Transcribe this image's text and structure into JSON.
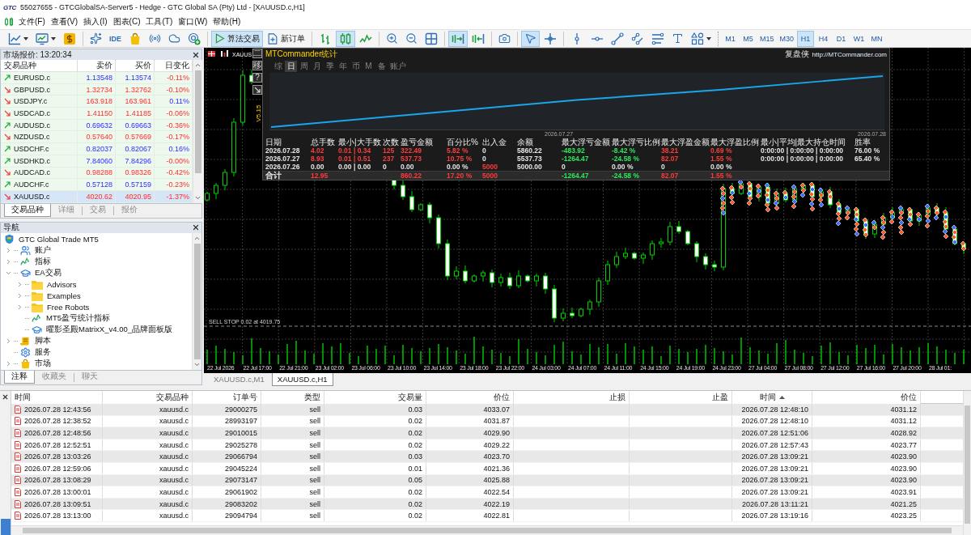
{
  "window": {
    "logo": "GTC",
    "title": "55027655 - GTCGlobalSA-Server5 - Hedge - GTC Global SA (Pty) Ltd - [XAUUSD.c,H1]"
  },
  "menu": [
    "文件(F)",
    "查看(V)",
    "插入(I)",
    "图表(C)",
    "工具(T)",
    "窗口(W)",
    "帮助(H)"
  ],
  "toolbar": {
    "ide_label": "IDE",
    "algo_trading": {
      "label": "算法交易",
      "on": true
    },
    "new_order": {
      "label": "新订单"
    },
    "chart_types": [
      {
        "selected": false
      },
      {
        "selected": true
      },
      {
        "selected": false
      }
    ],
    "auto_scroll": {
      "on": true
    },
    "chart_shift": {
      "on": false
    },
    "cursor_modes": [
      {
        "selected": true
      },
      {
        "selected": false
      }
    ],
    "timeframes": [
      {
        "label": "M1",
        "selected": false
      },
      {
        "label": "M5",
        "selected": false
      },
      {
        "label": "M15",
        "selected": false
      },
      {
        "label": "M30",
        "selected": false
      },
      {
        "label": "H1",
        "selected": true
      },
      {
        "label": "H4",
        "selected": false
      },
      {
        "label": "D1",
        "selected": false
      },
      {
        "label": "W1",
        "selected": false
      },
      {
        "label": "MN",
        "selected": false
      }
    ]
  },
  "market_watch": {
    "title": "市场报价: 13:20:34",
    "columns": [
      "交易品种",
      "卖价",
      "买价",
      "日变化"
    ],
    "rows": [
      {
        "symbol": "EURUSD.c",
        "bid": "1.13548",
        "ask": "1.13574",
        "change": "-0.11%",
        "rising": true,
        "change_rising": false,
        "selected": false
      },
      {
        "symbol": "GBPUSD.c",
        "bid": "1.32734",
        "ask": "1.32762",
        "change": "-0.10%",
        "rising": false,
        "change_rising": false,
        "selected": false
      },
      {
        "symbol": "USDJPY.c",
        "bid": "163.918",
        "ask": "163.961",
        "change": "0.11%",
        "rising": false,
        "change_rising": true,
        "selected": false
      },
      {
        "symbol": "USDCAD.c",
        "bid": "1.41150",
        "ask": "1.41185",
        "change": "-0.06%",
        "rising": false,
        "change_rising": false,
        "selected": false
      },
      {
        "symbol": "AUDUSD.c",
        "bid": "0.69632",
        "ask": "0.69663",
        "change": "-0.36%",
        "rising": true,
        "change_rising": false,
        "selected": false
      },
      {
        "symbol": "NZDUSD.c",
        "bid": "0.57640",
        "ask": "0.57669",
        "change": "-0.17%",
        "rising": false,
        "change_rising": false,
        "selected": false
      },
      {
        "symbol": "USDCHF.c",
        "bid": "0.82037",
        "ask": "0.82067",
        "change": "0.16%",
        "rising": true,
        "change_rising": true,
        "selected": false
      },
      {
        "symbol": "USDHKD.c",
        "bid": "7.84060",
        "ask": "7.84296",
        "change": "-0.00%",
        "rising": true,
        "change_rising": false,
        "selected": false
      },
      {
        "symbol": "AUDCAD.c",
        "bid": "0.98288",
        "ask": "0.98326",
        "change": "-0.42%",
        "rising": false,
        "change_rising": false,
        "selected": false
      },
      {
        "symbol": "AUDCHF.c",
        "bid": "0.57128",
        "ask": "0.57159",
        "change": "-0.23%",
        "rising": true,
        "change_rising": false,
        "selected": false
      },
      {
        "symbol": "XAUUSD.c",
        "bid": "4020.62",
        "ask": "4020.95",
        "change": "-1.37%",
        "rising": false,
        "change_rising": false,
        "selected": true
      }
    ],
    "tabs": [
      {
        "label": "交易品种",
        "selected": true
      },
      {
        "label": "详细",
        "selected": false
      },
      {
        "label": "交易",
        "selected": false
      },
      {
        "label": "报价",
        "selected": false
      }
    ]
  },
  "navigator": {
    "title": "导航",
    "tree": [
      {
        "label": "GTC Global Trade MT5",
        "kind": "root",
        "children": [
          {
            "label": "账户",
            "kind": "accounts",
            "expanded": false
          },
          {
            "label": "指标",
            "kind": "indicators",
            "expanded": false
          },
          {
            "label": "EA交易",
            "kind": "experts",
            "expanded": true,
            "children": [
              {
                "label": "Advisors",
                "kind": "folder",
                "expanded": false
              },
              {
                "label": "Examples",
                "kind": "folder",
                "expanded": false
              },
              {
                "label": "Free Robots",
                "kind": "folder",
                "expanded": false
              },
              {
                "label": "MT5盈亏统计指标",
                "kind": "indicator"
              },
              {
                "label": "曜影圣殿MatrixX_v4.00_品牌面板版",
                "kind": "expert"
              }
            ]
          },
          {
            "label": "脚本",
            "kind": "scripts",
            "expanded": false
          },
          {
            "label": "服务",
            "kind": "services"
          },
          {
            "label": "市场",
            "kind": "market",
            "expanded": false
          }
        ]
      }
    ],
    "tabs": [
      {
        "label": "注释",
        "selected": true
      },
      {
        "label": "收藏夹",
        "selected": false
      },
      {
        "label": "聊天",
        "selected": false
      }
    ]
  },
  "chart": {
    "symbol_label": "XAUUS",
    "version": "V5.15",
    "side_buttons": [
      "二",
      "移",
      "?"
    ],
    "pending_order": "SELL STOP 0.02 at 4019.75",
    "time_labels": [
      "22 Jul 2026",
      "22 Jul 17:00",
      "22 Jul 21:00",
      "23 Jul 02:00",
      "23 Jul 06:00",
      "23 Jul 10:00",
      "23 Jul 14:00",
      "23 Jul 18:00",
      "23 Jul 22:00",
      "24 Jul 03:00",
      "24 Jul 07:00",
      "24 Jul 11:00",
      "24 Jul 15:00",
      "24 Jul 19:00",
      "24 Jul 23:00",
      "27 Jul 04:00",
      "27 Jul 08:00",
      "27 Jul 12:00",
      "27 Jul 16:00",
      "27 Jul 20:00",
      "28 Jul 01:"
    ]
  },
  "stats_panel": {
    "title": "MTCommander统计",
    "brand": "复盘侠",
    "url": "http://MTCommander.com",
    "tabs": [
      {
        "label": "综",
        "selected": false
      },
      {
        "label": "日",
        "selected": true
      },
      {
        "label": "周",
        "selected": false
      },
      {
        "label": "月",
        "selected": false
      },
      {
        "label": "季",
        "selected": false
      },
      {
        "label": "年",
        "selected": false
      },
      {
        "label": "币",
        "selected": false
      },
      {
        "label": "M",
        "selected": false
      },
      {
        "label": "备",
        "selected": false
      },
      {
        "label": "账户",
        "selected": false
      }
    ],
    "date_labels": [
      "2026.07.27",
      "2026.07.28"
    ],
    "columns": [
      "日期",
      "总手数",
      "最小|大手数",
      "次数",
      "盈亏金额",
      "百分比%",
      "出入金",
      "余额",
      "最大浮亏金额",
      "最大浮亏比例",
      "最大浮盈金额",
      "最大浮盈比例",
      "最小|平均|最大持仓时间",
      "胜率"
    ],
    "rows": [
      {
        "date": {
          "text": "2026.07.28",
          "color": "#e6e6e6"
        },
        "total_lots": {
          "text": "4.02",
          "color": "#ff3b3b"
        },
        "min_max_lots": {
          "text": "0.01 | 0.34",
          "color": "#ff3b3b"
        },
        "trades": {
          "text": "125",
          "color": "#ff3b3b"
        },
        "profit": {
          "text": "322.49",
          "color": "#ff3b3b"
        },
        "percent": {
          "text": "5.82 %",
          "color": "#ff3b3b"
        },
        "deposit": {
          "text": "0",
          "color": "#e6e6e6"
        },
        "balance": {
          "text": "5860.22",
          "color": "#e6e6e6"
        },
        "max_float_loss": {
          "text": "-483.92",
          "color": "#2ee85c"
        },
        "max_float_loss_pct": {
          "text": "-8.42 %",
          "color": "#2ee85c"
        },
        "max_float_profit": {
          "text": "38.21",
          "color": "#ff3b3b"
        },
        "max_float_profit_pct": {
          "text": "0.69 %",
          "color": "#ff3b3b"
        },
        "hold_times": {
          "text": "0:00:00 | 0:00:00 | 0:00:00",
          "color": "#e6e6e6"
        },
        "win_rate": {
          "text": "76.00 %",
          "color": "#e6e6e6"
        }
      },
      {
        "date": {
          "text": "2026.07.27",
          "color": "#e6e6e6"
        },
        "total_lots": {
          "text": "8.93",
          "color": "#ff3b3b"
        },
        "min_max_lots": {
          "text": "0.01 | 0.51",
          "color": "#ff3b3b"
        },
        "trades": {
          "text": "237",
          "color": "#ff3b3b"
        },
        "profit": {
          "text": "537.73",
          "color": "#ff3b3b"
        },
        "percent": {
          "text": "10.75 %",
          "color": "#ff3b3b"
        },
        "deposit": {
          "text": "0",
          "color": "#e6e6e6"
        },
        "balance": {
          "text": "5537.73",
          "color": "#e6e6e6"
        },
        "max_float_loss": {
          "text": "-1264.47",
          "color": "#2ee85c"
        },
        "max_float_loss_pct": {
          "text": "-24.58 %",
          "color": "#2ee85c"
        },
        "max_float_profit": {
          "text": "82.07",
          "color": "#ff3b3b"
        },
        "max_float_profit_pct": {
          "text": "1.55 %",
          "color": "#ff3b3b"
        },
        "hold_times": {
          "text": "0:00:00 | 0:00:00 | 0:00:00",
          "color": "#e6e6e6"
        },
        "win_rate": {
          "text": "65.40 %",
          "color": "#e6e6e6"
        }
      },
      {
        "date": {
          "text": "2026.07.26",
          "color": "#e6e6e6"
        },
        "total_lots": {
          "text": "0.00",
          "color": "#e6e6e6"
        },
        "min_max_lots": {
          "text": "0.00 | 0.00",
          "color": "#e6e6e6"
        },
        "trades": {
          "text": "0",
          "color": "#e6e6e6"
        },
        "profit": {
          "text": "0.00",
          "color": "#e6e6e6"
        },
        "percent": {
          "text": "0.00 %",
          "color": "#e6e6e6"
        },
        "deposit": {
          "text": "5000",
          "color": "#ff3b3b"
        },
        "balance": {
          "text": "5000.00",
          "color": "#e6e6e6"
        },
        "max_float_loss": {
          "text": "0",
          "color": "#e6e6e6"
        },
        "max_float_loss_pct": {
          "text": "0.00 %",
          "color": "#e6e6e6"
        },
        "max_float_profit": {
          "text": "0",
          "color": "#e6e6e6"
        },
        "max_float_profit_pct": {
          "text": "0.00 %",
          "color": "#e6e6e6"
        }
      }
    ],
    "total": {
      "date": {
        "text": "合计",
        "color": "#e6e6e6"
      },
      "total_lots": {
        "text": "12.95",
        "color": "#ff3b3b"
      },
      "profit": {
        "text": "860.22",
        "color": "#ff3b3b"
      },
      "percent": {
        "text": "17.20 %",
        "color": "#ff3b3b"
      },
      "deposit": {
        "text": "5000",
        "color": "#ff3b3b"
      },
      "max_float_loss": {
        "text": "-1264.47",
        "color": "#2ee85c"
      },
      "max_float_loss_pct": {
        "text": "-24.58 %",
        "color": "#2ee85c"
      },
      "max_float_profit": {
        "text": "82.07",
        "color": "#ff3b3b"
      },
      "max_float_profit_pct": {
        "text": "1.55 %",
        "color": "#ff3b3b"
      }
    }
  },
  "chart_tabs": [
    {
      "label": "XAUUSD.c,M1",
      "selected": false
    },
    {
      "label": "XAUUSD.c,H1",
      "selected": true
    }
  ],
  "toolbox": {
    "columns": [
      {
        "label": "时间",
        "sorted": false
      },
      {
        "label": "交易品种",
        "sorted": false
      },
      {
        "label": "订单号",
        "sorted": false
      },
      {
        "label": "类型",
        "sorted": false
      },
      {
        "label": "交易量",
        "sorted": false
      },
      {
        "label": "价位",
        "sorted": false
      },
      {
        "label": "止损",
        "sorted": false
      },
      {
        "label": "止盈",
        "sorted": false
      },
      {
        "label": "时间",
        "sorted": true
      },
      {
        "label": "价位",
        "sorted": false
      }
    ],
    "rows": [
      {
        "open_time": "2026.07.28 12:43:56",
        "symbol": "xauusd.c",
        "order": "29000275",
        "type": "sell",
        "volume": "0.03",
        "price": "4033.07",
        "close_time": "2026.07.28 12:48:10",
        "close_price": "4031.12"
      },
      {
        "open_time": "2026.07.28 12:38:52",
        "symbol": "xauusd.c",
        "order": "28993197",
        "type": "sell",
        "volume": "0.02",
        "price": "4031.87",
        "close_time": "2026.07.28 12:48:10",
        "close_price": "4031.12"
      },
      {
        "open_time": "2026.07.28 12:48:56",
        "symbol": "xauusd.c",
        "order": "29010015",
        "type": "sell",
        "volume": "0.02",
        "price": "4029.90",
        "close_time": "2026.07.28 12:51:06",
        "close_price": "4028.92"
      },
      {
        "open_time": "2026.07.28 12:52:51",
        "symbol": "xauusd.c",
        "order": "29025278",
        "type": "sell",
        "volume": "0.02",
        "price": "4029.22",
        "close_time": "2026.07.28 12:57:43",
        "close_price": "4023.77"
      },
      {
        "open_time": "2026.07.28 13:03:26",
        "symbol": "xauusd.c",
        "order": "29066794",
        "type": "sell",
        "volume": "0.03",
        "price": "4023.70",
        "close_time": "2026.07.28 13:09:21",
        "close_price": "4023.90"
      },
      {
        "open_time": "2026.07.28 12:59:06",
        "symbol": "xauusd.c",
        "order": "29045224",
        "type": "sell",
        "volume": "0.01",
        "price": "4021.36",
        "close_time": "2026.07.28 13:09:21",
        "close_price": "4023.90"
      },
      {
        "open_time": "2026.07.28 13:08:29",
        "symbol": "xauusd.c",
        "order": "29073147",
        "type": "sell",
        "volume": "0.05",
        "price": "4025.88",
        "close_time": "2026.07.28 13:09:21",
        "close_price": "4023.90"
      },
      {
        "open_time": "2026.07.28 13:00:01",
        "symbol": "xauusd.c",
        "order": "29061902",
        "type": "sell",
        "volume": "0.02",
        "price": "4022.54",
        "close_time": "2026.07.28 13:09:21",
        "close_price": "4023.91"
      },
      {
        "open_time": "2026.07.28 13:09:51",
        "symbol": "xauusd.c",
        "order": "29083202",
        "type": "sell",
        "volume": "0.02",
        "price": "4022.19",
        "close_time": "2026.07.28 13:11:21",
        "close_price": "4021.25"
      },
      {
        "open_time": "2026.07.28 13:13:00",
        "symbol": "xauusd.c",
        "order": "29094794",
        "type": "sell",
        "volume": "0.02",
        "price": "4022.81",
        "close_time": "2026.07.28 13:19:16",
        "close_price": "4023.25"
      }
    ]
  }
}
